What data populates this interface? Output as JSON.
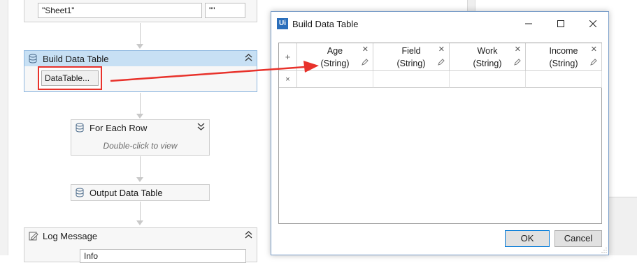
{
  "workflow": {
    "top_fields": {
      "sheet_value": "\"Sheet1\"",
      "range_value": "\"\""
    },
    "build_data_table": {
      "title": "Build Data Table",
      "datatable_button": "DataTable..."
    },
    "for_each_row": {
      "title": "For Each Row",
      "hint": "Double-click to view"
    },
    "output_data_table": {
      "title": "Output Data Table"
    },
    "log_message": {
      "title": "Log Message",
      "field_value": "Info"
    }
  },
  "dialog": {
    "app_icon_text": "Ui",
    "title": "Build Data Table",
    "columns": [
      {
        "name": "Age",
        "type": "(String)"
      },
      {
        "name": "Field",
        "type": "(String)"
      },
      {
        "name": "Work",
        "type": "(String)"
      },
      {
        "name": "Income",
        "type": "(String)"
      }
    ],
    "add_column_symbol": "+",
    "remove_row_symbol": "×",
    "ok_label": "OK",
    "cancel_label": "Cancel"
  },
  "colors": {
    "accent_red": "#e8322b",
    "selected_header": "#c7e0f4",
    "dialog_border": "#7a9ec9"
  }
}
